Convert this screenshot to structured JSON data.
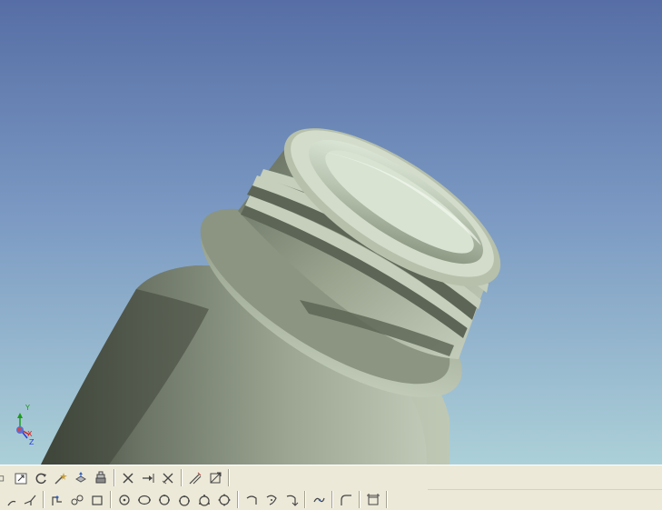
{
  "viewport": {
    "model": "bottle-neck-threaded",
    "background_top": "#5670a6",
    "background_bottom": "#a8ccd8",
    "body_color": "#8d9685"
  },
  "triad": {
    "y_label": "Y",
    "x_label": "X",
    "z_label": "Z",
    "y_color": "#1a9c1a",
    "x_color": "#d42020",
    "z_color": "#2a3adc"
  },
  "toolbar": {
    "row1": [
      {
        "icon": "view-window-icon"
      },
      {
        "icon": "zoom-fit-icon"
      },
      {
        "icon": "rotate-view-icon"
      },
      {
        "icon": "sketch-wand-icon"
      },
      {
        "icon": "extrude-icon"
      },
      {
        "icon": "stack-icon"
      },
      {
        "icon": "trim-icon"
      },
      {
        "icon": "extend-icon"
      },
      {
        "icon": "delete-geometry-icon"
      },
      {
        "icon": "smart-dimension-icon"
      },
      {
        "icon": "constraint-icon"
      }
    ],
    "row2": [
      {
        "icon": "arc-icon"
      },
      {
        "icon": "angle-line-icon"
      },
      {
        "icon": "polyline-icon"
      },
      {
        "icon": "spline-icon"
      },
      {
        "icon": "rectangle-icon"
      },
      {
        "icon": "circle-center-icon"
      },
      {
        "icon": "ellipse-icon"
      },
      {
        "icon": "circle-3pt-icon"
      },
      {
        "icon": "circle-tangent-icon"
      },
      {
        "icon": "polygon-icon"
      },
      {
        "icon": "gear-circle-icon"
      },
      {
        "icon": "arc-3pt-icon"
      },
      {
        "icon": "arc-tangent-icon"
      },
      {
        "icon": "arc-center-icon"
      },
      {
        "icon": "curve-edit-icon"
      },
      {
        "icon": "fillet-icon"
      },
      {
        "icon": "dimension-box-icon"
      }
    ]
  }
}
